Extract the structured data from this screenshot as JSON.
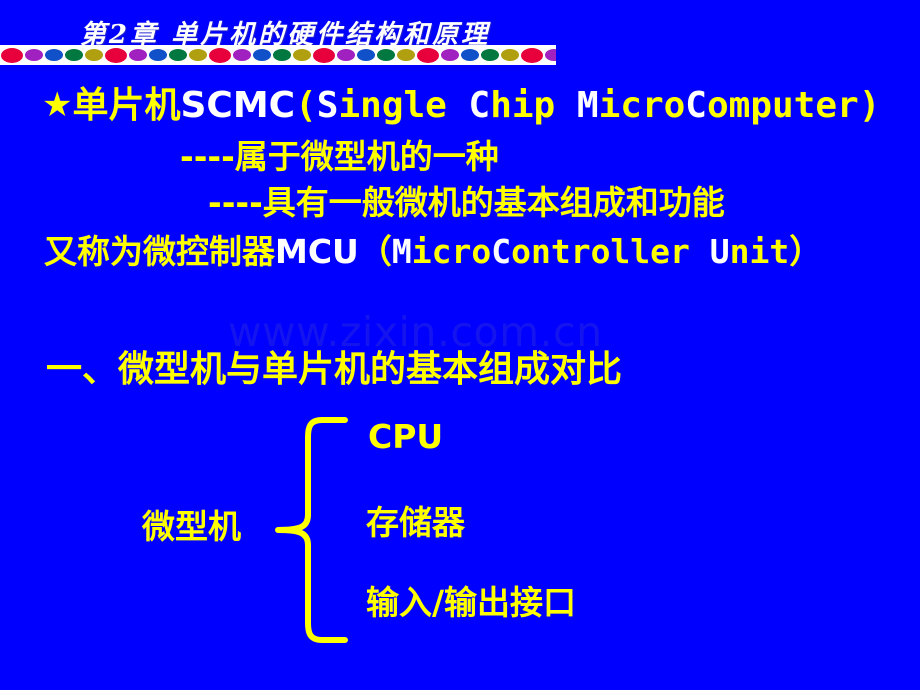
{
  "slide": {
    "background_color": "#0000ff",
    "accent_color": "#ffff00",
    "highlight_color": "#ffffff",
    "title": "第2章 单片机的硬件结构和原理"
  },
  "decor_bar": {
    "dot_colors": [
      "#e8003c",
      "#a020c0",
      "#1050c8",
      "#007840",
      "#b0a010"
    ],
    "repeat": 6
  },
  "body": {
    "line1": {
      "bullet": "★",
      "cn": "单片机",
      "acronym": "SCMC",
      "paren_open": "(",
      "expansion_parts": [
        {
          "text": "S",
          "highlight": true
        },
        {
          "text": "ingle ",
          "highlight": false
        },
        {
          "text": "C",
          "highlight": true
        },
        {
          "text": "hip ",
          "highlight": false
        },
        {
          "text": "M",
          "highlight": true
        },
        {
          "text": "icro",
          "highlight": false
        },
        {
          "text": "C",
          "highlight": true
        },
        {
          "text": "omputer",
          "highlight": false
        }
      ],
      "paren_close": ")"
    },
    "line2": "----属于微型机的一种",
    "line3": "----具有一般微机的基本组成和功能",
    "line4": {
      "cn": "又称为微控制器",
      "acronym": "MCU",
      "paren_open": "（",
      "expansion_parts": [
        {
          "text": "M",
          "highlight": true
        },
        {
          "text": "icro",
          "highlight": false
        },
        {
          "text": "C",
          "highlight": true
        },
        {
          "text": "ontroller ",
          "highlight": false
        },
        {
          "text": "U",
          "highlight": true
        },
        {
          "text": "nit",
          "highlight": false
        }
      ],
      "paren_close": "）"
    }
  },
  "watermark": {
    "text": "www.zixin.com.cn",
    "color": "#1414ef"
  },
  "section": {
    "heading": "一、微型机与单片机的基本组成对比"
  },
  "diagram": {
    "parent_label": "微型机",
    "brace_color": "#ffff00",
    "items": [
      {
        "label": "CPU"
      },
      {
        "label": "存储器"
      },
      {
        "label": "输入/输出接口"
      }
    ]
  }
}
